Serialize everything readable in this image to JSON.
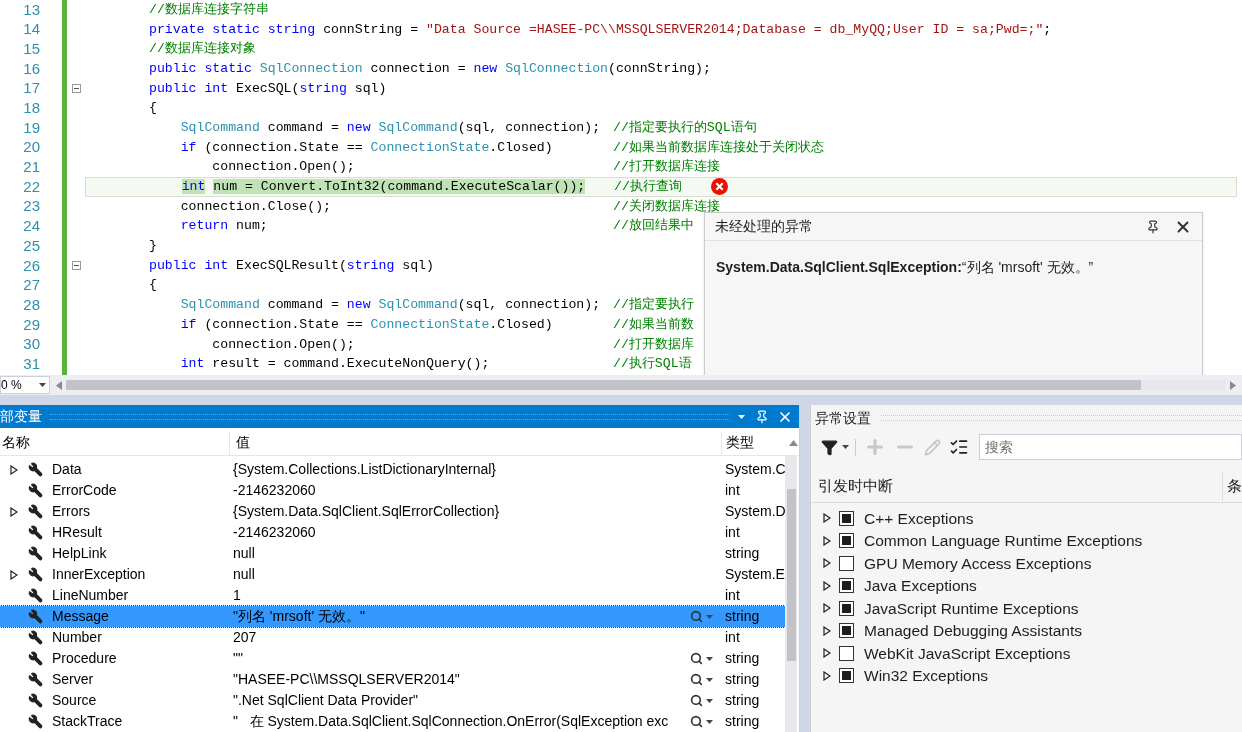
{
  "editor": {
    "lines": [
      {
        "number": "13",
        "foldable": false,
        "current": false,
        "error": false,
        "tokens": [
          {
            "kind": "comment",
            "text": "//数据库连接字符串"
          }
        ]
      },
      {
        "number": "14",
        "foldable": false,
        "current": false,
        "error": false,
        "tokens": [
          {
            "kind": "keyword",
            "text": "private static string"
          },
          {
            "kind": "plain",
            "text": " connString = "
          },
          {
            "kind": "string",
            "text": "\"Data Source =HASEE-PC\\\\MSSQLSERVER2014;Database = db_MyQQ;User ID = sa;Pwd=;\""
          },
          {
            "kind": "plain",
            "text": ";"
          }
        ]
      },
      {
        "number": "15",
        "foldable": false,
        "current": false,
        "error": false,
        "tokens": [
          {
            "kind": "comment",
            "text": "//数据库连接对象"
          }
        ]
      },
      {
        "number": "16",
        "foldable": false,
        "current": false,
        "error": false,
        "tokens": [
          {
            "kind": "keyword",
            "text": "public static "
          },
          {
            "kind": "type",
            "text": "SqlConnection"
          },
          {
            "kind": "plain",
            "text": " connection = "
          },
          {
            "kind": "keyword",
            "text": "new "
          },
          {
            "kind": "type",
            "text": "SqlConnection"
          },
          {
            "kind": "plain",
            "text": "(connString);"
          }
        ]
      },
      {
        "number": "17",
        "foldable": true,
        "current": false,
        "error": false,
        "tokens": [
          {
            "kind": "keyword",
            "text": "public int"
          },
          {
            "kind": "plain",
            "text": " ExecSQL("
          },
          {
            "kind": "keyword",
            "text": "string"
          },
          {
            "kind": "plain",
            "text": " sql)"
          }
        ]
      },
      {
        "number": "18",
        "foldable": false,
        "current": false,
        "error": false,
        "tokens": [
          {
            "kind": "plain",
            "text": "{"
          }
        ]
      },
      {
        "number": "19",
        "foldable": false,
        "current": false,
        "error": false,
        "tokens": [
          {
            "kind": "type",
            "text": "    SqlCommand"
          },
          {
            "kind": "plain",
            "text": " command = "
          },
          {
            "kind": "keyword",
            "text": "new "
          },
          {
            "kind": "type",
            "text": "SqlCommand"
          },
          {
            "kind": "plain",
            "text": "(sql, connection);"
          }
        ],
        "comment": "//指定要执行的SQL语句"
      },
      {
        "number": "20",
        "foldable": false,
        "current": false,
        "error": false,
        "tokens": [
          {
            "kind": "keyword",
            "text": "    if"
          },
          {
            "kind": "plain",
            "text": " (connection.State == "
          },
          {
            "kind": "type",
            "text": "ConnectionState"
          },
          {
            "kind": "plain",
            "text": ".Closed)"
          }
        ],
        "comment": "//如果当前数据库连接处于关闭状态"
      },
      {
        "number": "21",
        "foldable": false,
        "current": false,
        "error": false,
        "tokens": [
          {
            "kind": "plain",
            "text": "        connection.Open();"
          }
        ],
        "comment": "//打开数据库连接"
      },
      {
        "number": "22",
        "foldable": false,
        "current": true,
        "error": true,
        "tokens": [
          {
            "kind": "keyword",
            "text": "    int"
          },
          {
            "kind": "plain",
            "text": " num = Convert.ToInt32(command.ExecuteScalar());"
          }
        ],
        "comment": "//执行查询"
      },
      {
        "number": "23",
        "foldable": false,
        "current": false,
        "error": false,
        "tokens": [
          {
            "kind": "plain",
            "text": "    connection.Close();"
          }
        ],
        "comment": "//关闭数据库连接"
      },
      {
        "number": "24",
        "foldable": false,
        "current": false,
        "error": false,
        "tokens": [
          {
            "kind": "keyword",
            "text": "    return"
          },
          {
            "kind": "plain",
            "text": " num;"
          }
        ],
        "comment": "//放回结果中"
      },
      {
        "number": "25",
        "foldable": false,
        "current": false,
        "error": false,
        "tokens": [
          {
            "kind": "plain",
            "text": "}"
          }
        ]
      },
      {
        "number": "26",
        "foldable": true,
        "current": false,
        "error": false,
        "tokens": [
          {
            "kind": "keyword",
            "text": "public int"
          },
          {
            "kind": "plain",
            "text": " ExecSQLResult("
          },
          {
            "kind": "keyword",
            "text": "string"
          },
          {
            "kind": "plain",
            "text": " sql)"
          }
        ]
      },
      {
        "number": "27",
        "foldable": false,
        "current": false,
        "error": false,
        "tokens": [
          {
            "kind": "plain",
            "text": "{"
          }
        ]
      },
      {
        "number": "28",
        "foldable": false,
        "current": false,
        "error": false,
        "tokens": [
          {
            "kind": "type",
            "text": "    SqlCommand"
          },
          {
            "kind": "plain",
            "text": " command = "
          },
          {
            "kind": "keyword",
            "text": "new "
          },
          {
            "kind": "type",
            "text": "SqlCommand"
          },
          {
            "kind": "plain",
            "text": "(sql, connection);"
          }
        ],
        "comment": "//指定要执行"
      },
      {
        "number": "29",
        "foldable": false,
        "current": false,
        "error": false,
        "tokens": [
          {
            "kind": "keyword",
            "text": "    if"
          },
          {
            "kind": "plain",
            "text": " (connection.State == "
          },
          {
            "kind": "type",
            "text": "ConnectionState"
          },
          {
            "kind": "plain",
            "text": ".Closed)"
          }
        ],
        "comment": "//如果当前数"
      },
      {
        "number": "30",
        "foldable": false,
        "current": false,
        "error": false,
        "tokens": [
          {
            "kind": "plain",
            "text": "        connection.Open();"
          }
        ],
        "comment": "//打开数据库"
      },
      {
        "number": "31",
        "foldable": false,
        "current": false,
        "error": false,
        "tokens": [
          {
            "kind": "keyword",
            "text": "    int"
          },
          {
            "kind": "plain",
            "text": " result = command.ExecuteNonQuery();"
          }
        ],
        "comment": "//执行SQL语"
      }
    ]
  },
  "exception_popup": {
    "title": "未经处理的异常",
    "message": "**System.Data.SqlClient.SqlException:**“列名 'mrsoft' 无效。”"
  },
  "zoom": "0 %",
  "locals": {
    "title": "部变量",
    "columns": [
      "名称",
      "值",
      "类型"
    ],
    "rows": [
      {
        "name": "Data",
        "value": "{System.Collections.ListDictionaryInternal}",
        "type": "System.C",
        "expandable": true,
        "visualizer": false,
        "selected": false
      },
      {
        "name": "ErrorCode",
        "value": "-2146232060",
        "type": "int",
        "expandable": false,
        "visualizer": false,
        "selected": false
      },
      {
        "name": "Errors",
        "value": "{System.Data.SqlClient.SqlErrorCollection}",
        "type": "System.D",
        "expandable": true,
        "visualizer": false,
        "selected": false
      },
      {
        "name": "HResult",
        "value": "-2146232060",
        "type": "int",
        "expandable": false,
        "visualizer": false,
        "selected": false
      },
      {
        "name": "HelpLink",
        "value": "null",
        "type": "string",
        "expandable": false,
        "visualizer": false,
        "selected": false
      },
      {
        "name": "InnerException",
        "value": "null",
        "type": "System.E",
        "expandable": true,
        "visualizer": false,
        "selected": false
      },
      {
        "name": "LineNumber",
        "value": "1",
        "type": "int",
        "expandable": false,
        "visualizer": false,
        "selected": false
      },
      {
        "name": "Message",
        "value": "\"列名 'mrsoft' 无效。\"",
        "type": "string",
        "expandable": false,
        "visualizer": true,
        "selected": true
      },
      {
        "name": "Number",
        "value": "207",
        "type": "int",
        "expandable": false,
        "visualizer": false,
        "selected": false
      },
      {
        "name": "Procedure",
        "value": "\"\"",
        "type": "string",
        "expandable": false,
        "visualizer": true,
        "selected": false
      },
      {
        "name": "Server",
        "value": "\"HASEE-PC\\\\MSSQLSERVER2014\"",
        "type": "string",
        "expandable": false,
        "visualizer": true,
        "selected": false
      },
      {
        "name": "Source",
        "value": "\".Net SqlClient Data Provider\"",
        "type": "string",
        "expandable": false,
        "visualizer": true,
        "selected": false
      },
      {
        "name": "StackTrace",
        "value": "\"   在 System.Data.SqlClient.SqlConnection.OnError(SqlException exc",
        "type": "string",
        "expandable": false,
        "visualizer": true,
        "selected": false
      }
    ]
  },
  "exception_settings": {
    "title": "异常设置",
    "toolbar": [
      {
        "kind": "filter",
        "disabled": false
      },
      {
        "kind": "add",
        "disabled": true
      },
      {
        "kind": "remove",
        "disabled": true
      },
      {
        "kind": "edit",
        "disabled": true
      },
      {
        "kind": "list",
        "disabled": false
      }
    ],
    "search": {
      "placeholder": "搜索"
    },
    "columns": [
      "引发时中断",
      "条"
    ],
    "items": [
      {
        "label": "C++ Exceptions",
        "checked": true
      },
      {
        "label": "Common Language Runtime Exceptions",
        "checked": true
      },
      {
        "label": "GPU Memory Access Exceptions",
        "checked": false
      },
      {
        "label": "Java Exceptions",
        "checked": true
      },
      {
        "label": "JavaScript Runtime Exceptions",
        "checked": true
      },
      {
        "label": "Managed Debugging Assistants",
        "checked": true
      },
      {
        "label": "WebKit JavaScript Exceptions",
        "checked": false
      },
      {
        "label": "Win32 Exceptions",
        "checked": true
      }
    ]
  }
}
